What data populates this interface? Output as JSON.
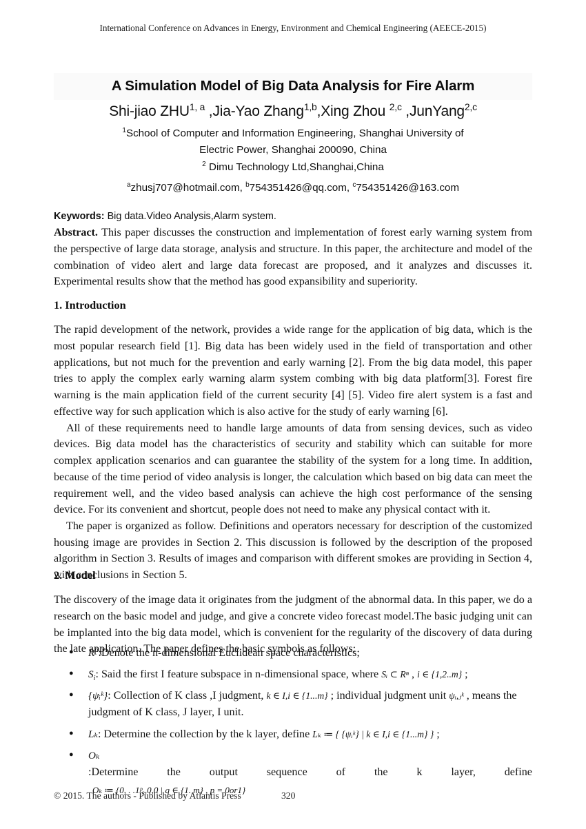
{
  "running_header": "International Conference on Advances in Energy, Environment and Chemical Engineering (AEECE-2015)",
  "title": "A Simulation Model of Big Data Analysis for Fire Alarm",
  "authors": {
    "a1_name": "Shi-jiao ZHU",
    "a1_sup": "1, a",
    "sep1": " ,",
    "a2_name": "Jia-Yao Zhang",
    "a2_sup": "1,b",
    "sep2": ",",
    "a3_name": "Xing Zhou ",
    "a3_sup": "2,c",
    "sep3": " ,",
    "a4_name": "JunYang",
    "a4_sup": "2,c"
  },
  "affiliations": [
    {
      "sup": "1",
      "text": "School of Computer and Information Engineering, Shanghai University of"
    },
    {
      "sup": "",
      "text": "Electric Power, Shanghai 200090, China"
    },
    {
      "sup": "2",
      "text": " Dimu Technology Ltd,Shanghai,China"
    }
  ],
  "emails": {
    "e1_sup": "a",
    "e1": "zhusj707@hotmail.com, ",
    "e2_sup": "b",
    "e2": "754351426@qq.com, ",
    "e3_sup": "c",
    "e3": "754351426@163.com"
  },
  "keywords": {
    "label": "Keywords:",
    "text": " Big data.Video Analysis,Alarm system."
  },
  "abstract": {
    "label": "Abstract.",
    "text": " This paper discusses the construction and implementation of forest early warning system from the perspective of large data storage, analysis and structure. In this paper, the architecture and model of the combination of video alert and large data forecast are proposed, and it analyzes and discusses it. Experimental results show that the method has good expansibility and superiority."
  },
  "sections": [
    {
      "heading": "1. Introduction",
      "paragraphs": [
        "The rapid development of the network, provides a wide range for the application of big data, which is the most popular research field [1]. Big data has been widely used in the field of transportation and other applications, but not much for the prevention and early warning [2]. From the big data model, this paper tries to apply the complex early warning alarm system combing with big data platform[3]. Forest fire warning is the main application field of the current security [4] [5]. Video fire alert system is a fast and effective way for such application which is  also active for the study of early warning [6].",
        "All of these requirements need to handle large amounts of data from sensing devices, such as video devices. Big data model has the characteristics of security and stability which can suitable for more complex application scenarios and can guarantee the stability of the system for a long time. In addition, because of the time period of video analysis is longer, the calculation which based on big data can meet the requirement well, and the video based analysis can achieve the high cost performance of the sensing device. For its convenient and shortcut, people does not need to make any physical contact with it.",
        "The paper is organized as follow. Definitions and operators necessary for description of the customized housing image are provides in Section 2. This discussion is followed by the description of the proposed algorithm in Section 3. Results of images and comparison with different smokes are providing in Section 4, with conclusions in Section 5."
      ]
    },
    {
      "heading": "2. Model",
      "paragraphs": [
        "The discovery of the image data it originates from the judgment of the abnormal data. In this paper, we do a research on the basic model and judge, and give a concrete video forecast model.The basic judging unit can be implanted into the big data model, which is convenient for the regularity of the discovery of data during the late application. The paper defines the basic symbols as follows:"
      ]
    }
  ],
  "symbol_list": [
    {
      "sym_base": "R",
      "sym_sup": "n",
      "sym_sub": "",
      "text": ":Denote the n-dimensional Euclidean space characteristics;"
    },
    {
      "sym_base": "S",
      "sym_sup": "",
      "sym_sub": "i",
      "text": ": Said the first I feature subspace in n-dimensional space, where ",
      "formula1": "Sᵢ ⊂ Rⁿ",
      "mid": " ,   ",
      "formula2": "i ∈ {1,2..m}",
      "tail": " ;"
    },
    {
      "sym_text": "{ψᵢᵏ}",
      "text": ": Collection of K class ,I judgment, ",
      "formula1": "k ∈ I,i ∈ {1...m}",
      "mid": " ; individual judgment unit ",
      "formula2": "ψᵢ,ⱼᵏ",
      "tail": " , means the judgment of K class, J layer, I unit."
    },
    {
      "sym_text": "Lₖ",
      "text": ": Determine the collection by the k layer, define ",
      "formula1": "Lₖ ≔ { {ψᵢᵏ} | k ∈ I,i ∈ {1...m} }",
      "tail": " ;"
    },
    {
      "sym_text": "Oₖ",
      "text_words": [
        ":Determine",
        "the",
        "output",
        "sequence",
        "of",
        "the",
        "k",
        "layer,",
        "define"
      ],
      "formula_display": "Oₖ ≔ {0, . .1ᵖₒ,0,0 | q ∈ {1. m} , p = 0or1}"
    }
  ],
  "footer": {
    "copyright": "© 2015. The authors - Published by Atlantis Press",
    "page_number": "320"
  }
}
